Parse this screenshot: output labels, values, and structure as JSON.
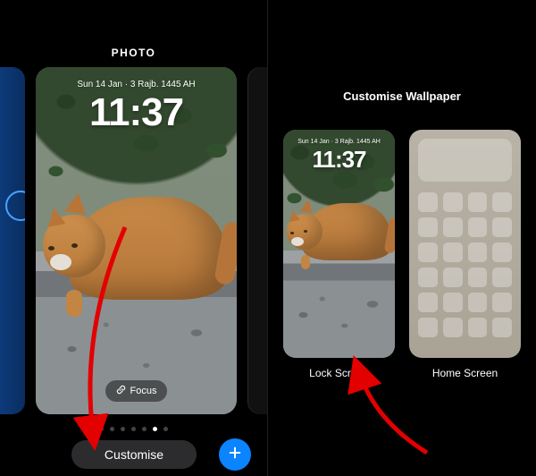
{
  "left": {
    "title": "PHOTO",
    "lock_date": "Sun 14 Jan · 3 Rajb. 1445 AH",
    "lock_time": "11:37",
    "focus_label": "Focus",
    "customise_label": "Customise",
    "page_dots": {
      "count": 7,
      "active_index": 5
    }
  },
  "right": {
    "title": "Customise Wallpaper",
    "lock_date": "Sun 14 Jan · 3 Rajb. 1445 AH",
    "lock_time": "11:37",
    "lock_label": "Lock Screen",
    "home_label": "Home Screen"
  }
}
